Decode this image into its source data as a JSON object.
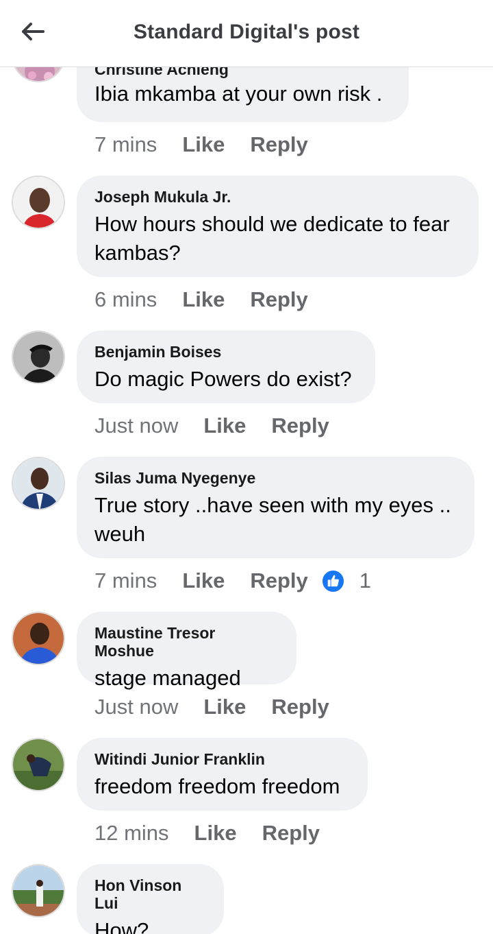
{
  "header": {
    "title": "Standard Digital's post",
    "back_icon": "back-arrow-icon"
  },
  "colors": {
    "bubble": "#eff1f4",
    "meta": "#65676b",
    "like_badge": "#1877f2"
  },
  "comments": [
    {
      "author": "Christine Achieng",
      "text": "Ibia mkamba at your own risk .",
      "time": "7 mins",
      "like": "Like",
      "reply": "Reply"
    },
    {
      "author": "Joseph Mukula Jr.",
      "text": "How hours should we dedicate to fear kambas?",
      "time": "6 mins",
      "like": "Like",
      "reply": "Reply"
    },
    {
      "author": "Benjamin Boises",
      "text": "Do magic Powers do exist?",
      "time": "Just now",
      "like": "Like",
      "reply": "Reply"
    },
    {
      "author": "Silas Juma Nyegenye",
      "text": "True story ..have seen with my eyes .. weuh",
      "time": "7 mins",
      "like": "Like",
      "reply": "Reply",
      "reactions": "1",
      "reaction_icon": "thumbs-up-icon"
    },
    {
      "author": "Maustine Tresor Moshue",
      "text": "stage managed",
      "time": "Just now",
      "like": "Like",
      "reply": "Reply"
    },
    {
      "author": "Witindi Junior Franklin",
      "text": "freedom freedom freedom",
      "time": "12 mins",
      "like": "Like",
      "reply": "Reply"
    },
    {
      "author": "Hon Vinson Lui",
      "text": "How?"
    }
  ]
}
